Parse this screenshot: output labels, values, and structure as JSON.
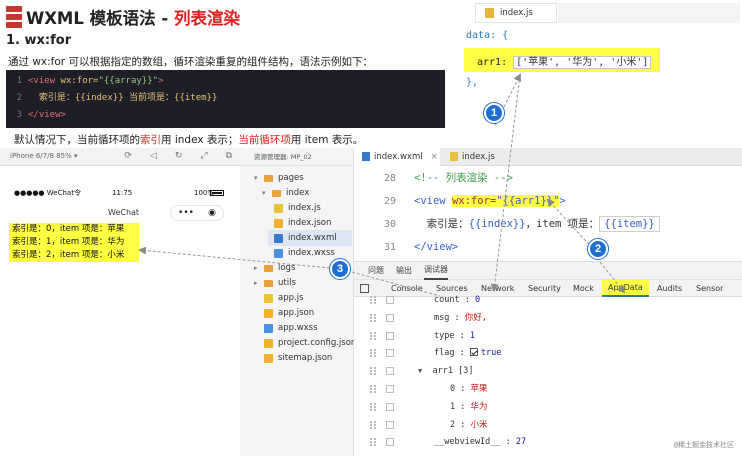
{
  "slide": {
    "title_main": "WXML 模板语法 - ",
    "title_accent": "列表渲染",
    "subtitle": "1. wx:for",
    "description": "通过 wx:for 可以根据指定的数组，循环渲染重复的组件结构，语法示例如下：",
    "code_lines": [
      {
        "num": "1",
        "tag_open": "<view ",
        "attr": "wx:for=",
        "value": "\"{{array}}\"",
        "tag_close": ">"
      },
      {
        "num": "2",
        "text": "索引是：{{index}} 当前项是：{{item}}"
      },
      {
        "num": "3",
        "tag": "</view>"
      }
    ],
    "note_a": "默认情况下，当前循环项的",
    "note_b": "索引",
    "note_c": "用 index 表示；",
    "note_d": "当前循环项",
    "note_e": "用 item 表示。"
  },
  "snippet": {
    "tab": "index.js",
    "line1": "data: {",
    "key": "arr1: ",
    "value": "['苹果', '华为', '小米']",
    "line3": "},"
  },
  "simulator": {
    "device": "iPhone 6/7/8 85% ▾",
    "toolbar_icons": [
      "refresh-icon",
      "volume-icon",
      "rotate-icon",
      "fullscreen-icon",
      "popout-icon"
    ],
    "status_left": "●●●●● WeChat令",
    "status_time": "11:75",
    "status_right": "100%",
    "nav_title": "WeChat",
    "capsule_more": "•••",
    "capsule_close": "◉",
    "output": [
      "索引是：0，item 项是：苹果",
      "索引是：1，item 项是：华为",
      "索引是：2，item 项是：小米"
    ]
  },
  "explorer": {
    "header": "资源管理器: MP_02",
    "items": [
      {
        "label": "pages",
        "type": "folder",
        "twisty": "▾"
      },
      {
        "label": "index",
        "type": "folder",
        "twisty": "▾"
      },
      {
        "label": "index.js",
        "type": "js"
      },
      {
        "label": "index.json",
        "type": "json"
      },
      {
        "label": "index.wxml",
        "type": "wxml",
        "selected": true
      },
      {
        "label": "index.wxss",
        "type": "wxss"
      },
      {
        "label": "logs",
        "type": "folder",
        "twisty": "▸"
      },
      {
        "label": "utils",
        "type": "folder",
        "twisty": "▸"
      },
      {
        "label": "app.js",
        "type": "js"
      },
      {
        "label": "app.json",
        "type": "json"
      },
      {
        "label": "app.wxss",
        "type": "wxss"
      },
      {
        "label": "project.config.json",
        "type": "json"
      },
      {
        "label": "sitemap.json",
        "type": "json"
      }
    ]
  },
  "editor": {
    "tab_active": "index.wxml",
    "tab_close": "×",
    "tab_other": "index.js",
    "lines": [
      {
        "num": "28",
        "comment": "<!-- 列表渲染 -->"
      },
      {
        "num": "29",
        "tag_open": "<view ",
        "attr": "wx:for=",
        "value": "\"{{arr1}}\"",
        "tag_close": ">"
      },
      {
        "num": "30",
        "t1": "索引是：",
        "b1": "{{index}}",
        "t2": "，item 项是：",
        "b2": "{{item}}"
      },
      {
        "num": "31",
        "tag": "</view>"
      }
    ]
  },
  "devtools": {
    "panel_tabs": [
      "问题",
      "输出",
      "调试器"
    ],
    "active_panel": "调试器",
    "tabs": [
      "Console",
      "Sources",
      "Network",
      "Security",
      "Mock",
      "AppData",
      "Audits",
      "Sensor"
    ],
    "active_tab": "AppData",
    "rows": [
      {
        "key": "count",
        "sep": " : ",
        "value": "0",
        "kind": "num"
      },
      {
        "key": "msg",
        "sep": "  : ",
        "value": "你好,",
        "kind": "str"
      },
      {
        "key": "type",
        "sep": " : ",
        "value": "1",
        "kind": "num"
      },
      {
        "key": "flag",
        "sep": " : ",
        "value": "true",
        "kind": "bool"
      },
      {
        "key": "arr1",
        "sep": "  ",
        "value": "[3]",
        "kind": "arr"
      },
      {
        "key": "0",
        "sep": " : ",
        "value": "苹果",
        "kind": "str"
      },
      {
        "key": "1",
        "sep": " : ",
        "value": "华为",
        "kind": "str"
      },
      {
        "key": "2",
        "sep": " : ",
        "value": "小米",
        "kind": "str"
      },
      {
        "key": "__webviewId__",
        "sep": " : ",
        "value": "27",
        "kind": "num"
      }
    ],
    "watermark": "@稀土掘金技术社区"
  },
  "callouts": [
    "1",
    "2",
    "3"
  ],
  "colors": {
    "highlight": "#ffff44",
    "accent_red": "#e02020",
    "badge_blue": "#1f6fd1",
    "code_bg": "#1e1f26"
  }
}
